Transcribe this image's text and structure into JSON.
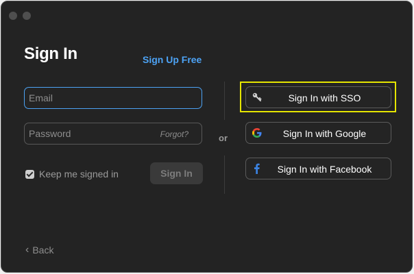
{
  "header": {
    "title": "Sign In",
    "signup_label": "Sign Up Free"
  },
  "form": {
    "email_placeholder": "Email",
    "password_placeholder": "Password",
    "forgot_label": "Forgot?",
    "keep_signed_in_label": "Keep me signed in",
    "keep_signed_in_checked": true,
    "signin_label": "Sign In"
  },
  "separator": {
    "label": "or"
  },
  "providers": [
    {
      "label": "Sign In with SSO",
      "icon": "key-icon"
    },
    {
      "label": "Sign In with Google",
      "icon": "google-icon"
    },
    {
      "label": "Sign In with Facebook",
      "icon": "facebook-icon"
    }
  ],
  "footer": {
    "back_label": "Back"
  },
  "colors": {
    "accent": "#4da3f5",
    "highlight": "#e6e600",
    "background": "#232323"
  }
}
